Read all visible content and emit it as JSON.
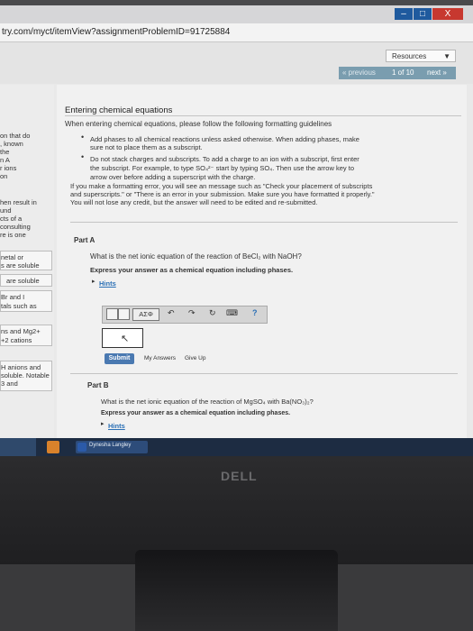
{
  "browser": {
    "url": "try.com/myct/itemView?assignmentProblemID=91725884",
    "window_buttons": [
      "–",
      "□",
      "X"
    ]
  },
  "toolbar_top": {
    "resources_label": "Resources",
    "resources_arrow": "▼",
    "previous_label": "« previous",
    "position": "1 of 10",
    "next_label": "next »"
  },
  "sidebar": {
    "lines_top": [
      "on that do",
      ", known",
      "the",
      "n A",
      "r ions",
      "on"
    ],
    "lines_mid": [
      "hen result in",
      "und",
      "cts of a",
      "consulting",
      "re is one"
    ],
    "box1": [
      "netal or",
      "s are soluble"
    ],
    "box2": [
      "are soluble"
    ],
    "box3": [
      "Br  and I",
      "tals such as"
    ],
    "box4": [
      "ns and Mg2+",
      "+2 cations"
    ],
    "box5": [
      "H   anions and",
      "soluble. Notable",
      "3 and"
    ]
  },
  "main": {
    "heading": "Entering chemical equations",
    "intro": "When entering chemical equations, please follow the following formatting guidelines",
    "bullet1_l1": "Add phases to all chemical reactions unless asked otherwise. When adding phases, make",
    "bullet1_l2": "sure not to place them as a subscript.",
    "bullet2_l1": "Do not stack charges and subscripts. To add a charge to an ion with a subscript, first enter",
    "bullet2_l2": "the subscript. For example, to type SO₄²⁻ start by typing SO₄. Then use the arrow key to",
    "bullet2_l3": "arrow over before adding a superscript with the charge.",
    "para1_l1": "If you make a formatting error, you will see an message such as \"Check your placement of subscripts",
    "para1_l2": "and superscripts.\" or \"There is an error in your submission. Make sure you have formatted it properly.\"",
    "para1_l3": "You will not lose any credit, but the answer will need to be edited and re-submitted.",
    "partA_label": "Part A",
    "partA_question": "What is the net ionic equation of the reaction of BeCl₂ with NaOH?",
    "partA_instruction": "Express your answer as a chemical equation including phases.",
    "hints_label": "Hints",
    "greek_button": "ΑΣΦ",
    "help_icon": "?",
    "submit_label": "Submit",
    "my_answers_label": "My Answers",
    "give_up_label": "Give Up",
    "partB_label": "Part B",
    "partB_question": "What is the net ionic equation of the reaction of MgSO₄ with Ba(NO₃)₂?",
    "partB_instruction": "Express your answer as a chemical equation including phases.",
    "partB_hints_label": "Hints"
  },
  "taskbar": {
    "word_task_label": "Dynesha Langley",
    "monitor_brand": "DELL"
  }
}
